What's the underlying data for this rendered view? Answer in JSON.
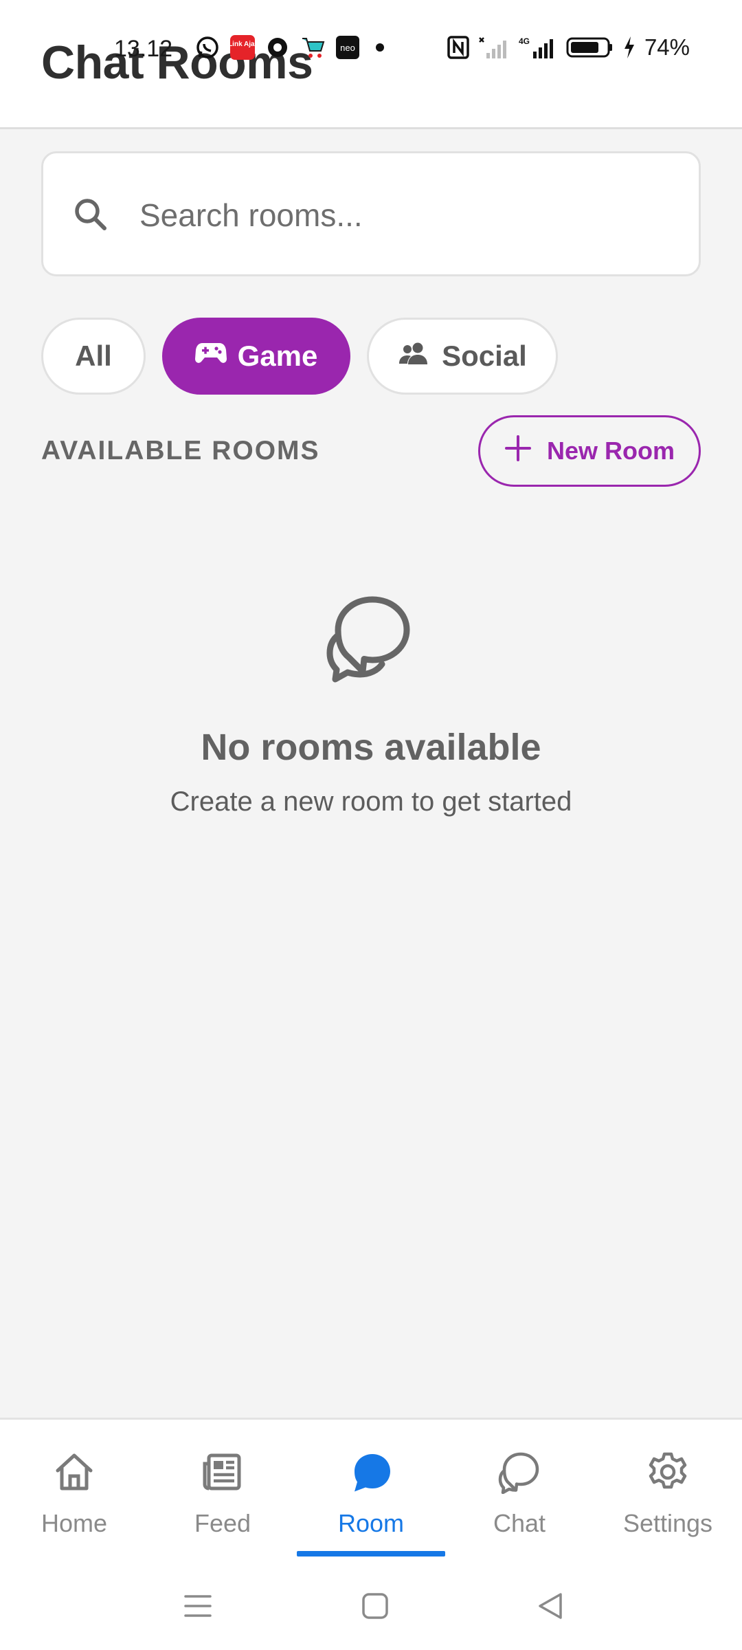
{
  "status_bar": {
    "time": "13.12",
    "battery": "74%",
    "left_icons": [
      "whatsapp-icon",
      "linkaja-app-icon",
      "record-icon",
      "shopping-cart-icon",
      "neo-app-icon",
      "dot-icon"
    ],
    "right_icons": [
      "nfc-icon",
      "signal-off-icon",
      "4g-signal-icon",
      "battery-icon",
      "charging-icon"
    ],
    "neo_label": "neo",
    "linkaja_label": "Link Aja!"
  },
  "header": {
    "title": "Chat Rooms"
  },
  "search": {
    "placeholder": "Search rooms...",
    "value": ""
  },
  "filters": [
    {
      "label": "All",
      "active": false,
      "icon": ""
    },
    {
      "label": "Game",
      "active": true,
      "icon": "gamepad-icon"
    },
    {
      "label": "Social",
      "active": false,
      "icon": "people-icon"
    }
  ],
  "section": {
    "label": "AVAILABLE ROOMS",
    "new_room_label": "New Room"
  },
  "empty_state": {
    "icon": "chat-bubbles-icon",
    "title": "No rooms available",
    "subtitle": "Create a new room to get started"
  },
  "bottom_nav": [
    {
      "label": "Home",
      "icon": "home-icon",
      "active": false
    },
    {
      "label": "Feed",
      "icon": "newspaper-icon",
      "active": false
    },
    {
      "label": "Room",
      "icon": "chat-bubble-icon",
      "active": true
    },
    {
      "label": "Chat",
      "icon": "chat-bubbles-outline-icon",
      "active": false
    },
    {
      "label": "Settings",
      "icon": "gear-icon",
      "active": false
    }
  ],
  "colors": {
    "accent": "#9a26ae",
    "nav_active": "#1678e6",
    "background": "#f4f4f4"
  }
}
